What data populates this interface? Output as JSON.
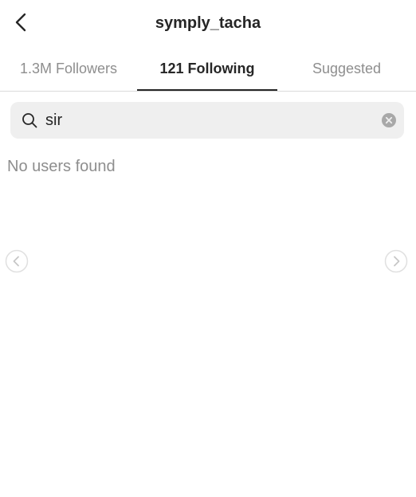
{
  "header": {
    "title": "symply_tacha",
    "back_icon": "chevron-left-icon"
  },
  "tabs": [
    {
      "label": "1.3M Followers",
      "active": false
    },
    {
      "label": "121 Following",
      "active": true
    },
    {
      "label": "Suggested",
      "active": false
    }
  ],
  "search": {
    "value": "sir",
    "icon": "search-icon",
    "clear_icon": "clear-icon"
  },
  "results": {
    "empty_message": "No users found"
  },
  "carousel": {
    "prev_icon": "chevron-left-icon",
    "next_icon": "chevron-right-icon"
  },
  "colors": {
    "text_primary": "#262626",
    "text_secondary": "#8e8e8e",
    "search_bg": "#efefef",
    "divider": "#dbdbdb"
  }
}
